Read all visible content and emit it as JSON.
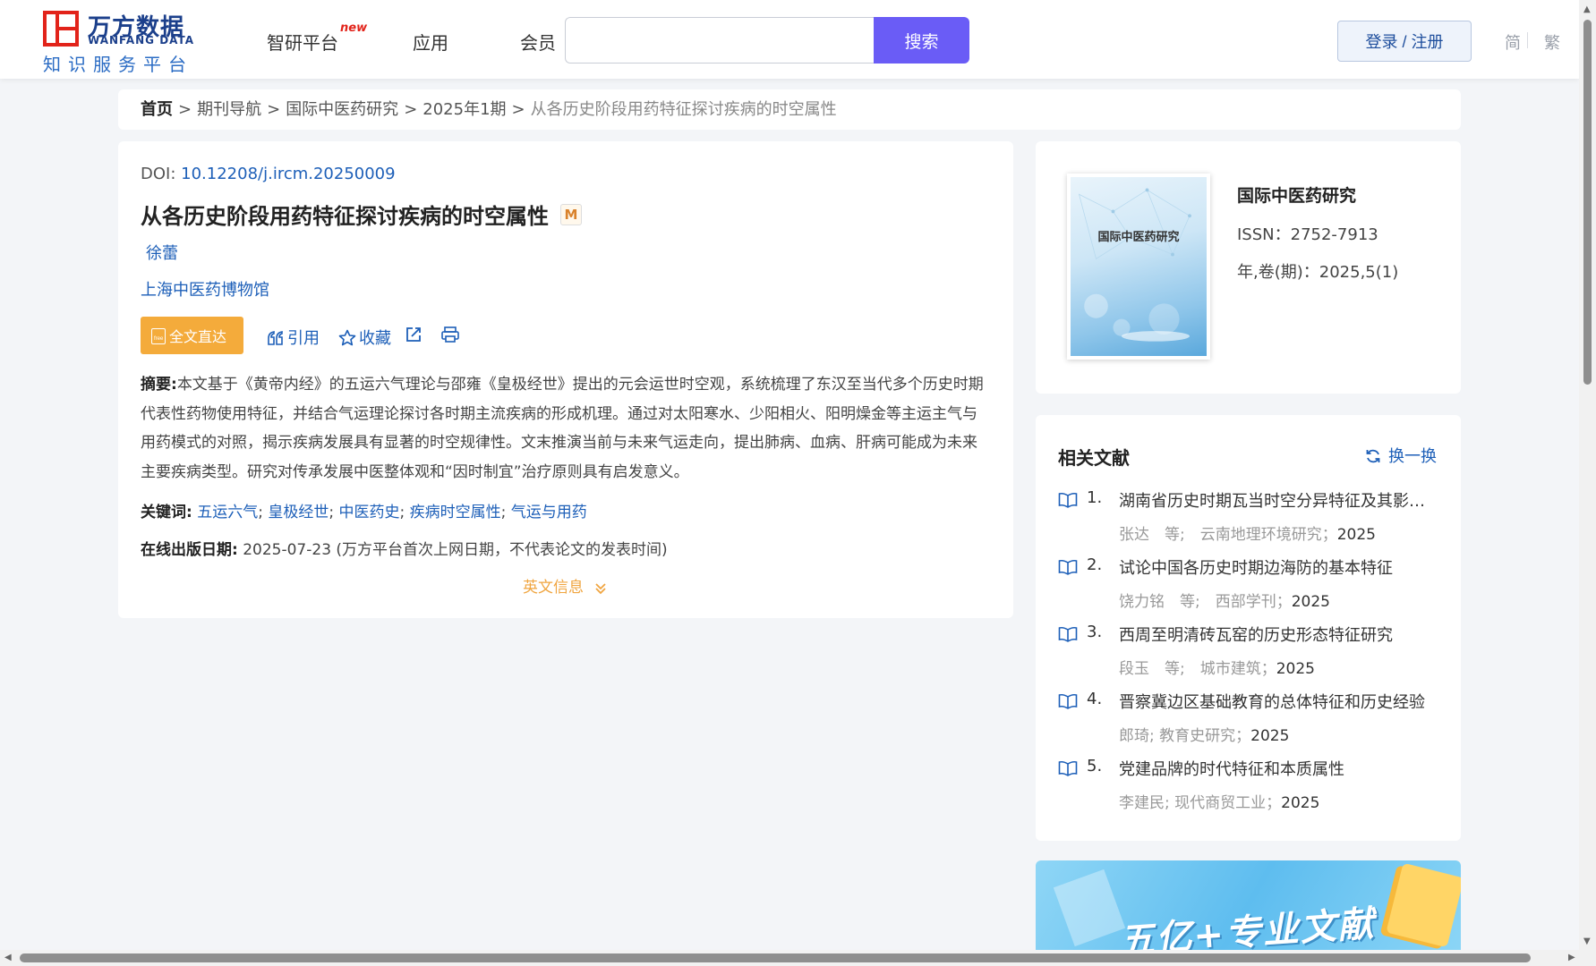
{
  "header": {
    "logo_cn": "万方数据",
    "logo_en": "WANFANG DATA",
    "logo_sub": "知识服务平台",
    "nav": [
      {
        "label": "智研平台",
        "badge": "new"
      },
      {
        "label": "应用"
      },
      {
        "label": "会员"
      }
    ],
    "search_placeholder": "",
    "search_button": "搜索",
    "login_button": "登录 / 注册",
    "lang_simplified": "简",
    "lang_traditional": "繁"
  },
  "breadcrumb": {
    "home": "首页",
    "sep": ">",
    "items": [
      "期刊导航",
      "国际中医药研究",
      "2025年1期"
    ],
    "current": "从各历史阶段用药特征探讨疾病的时空属性"
  },
  "article": {
    "doi_label": "DOI:",
    "doi_value": "10.12208/j.ircm.20250009",
    "title": "从各历史阶段用药特征探讨疾病的时空属性",
    "badge": "M",
    "author": "徐蕾",
    "organization": "上海中医药博物馆",
    "fulltext_button": "全文直达",
    "actions": {
      "cite": "引用",
      "favorite": "收藏"
    },
    "abstract_label": "摘要:",
    "abstract": "本文基于《黄帝内经》的五运六气理论与邵雍《皇极经世》提出的元会运世时空观，系统梳理了东汉至当代多个历史时期代表性药物使用特征，并结合气运理论探讨各时期主流疾病的形成机理。通过对太阳寒水、少阳相火、阳明燥金等主运主气与用药模式的对照，揭示疾病发展具有显著的时空规律性。文末推演当前与未来气运走向，提出肺病、血病、肝病可能成为未来主要疾病类型。研究对传承发展中医整体观和“因时制宜”治疗原则具有启发意义。",
    "keywords_label": "关键词:",
    "keywords": [
      "五运六气",
      "皇极经世",
      "中医药史",
      "疾病时空属性",
      "气运与用药"
    ],
    "keyword_sep": ";",
    "pubdate_label": "在线出版日期:",
    "pubdate_value": "2025-07-23",
    "pubdate_note": "(万方平台首次上网日期，不代表论文的发表时间)",
    "english_info": "英文信息"
  },
  "journal": {
    "cover_title": "国际中医药研究",
    "name": "国际中医药研究",
    "issn": "ISSN：2752-7913",
    "volume": "年,卷(期)：2025,5(1)"
  },
  "related": {
    "title": "相关文献",
    "refresh": "换一换",
    "items": [
      {
        "num": "1.",
        "title": "湖南省历史时期瓦当时空分异特征及其影响...",
        "meta": "张达　等;　云南地理环境研究；",
        "year": "2025"
      },
      {
        "num": "2.",
        "title": "试论中国各历史时期边海防的基本特征",
        "meta": "饶力铭　等;　西部学刊；",
        "year": "2025"
      },
      {
        "num": "3.",
        "title": "西周至明清砖瓦窑的历史形态特征研究",
        "meta": "段玉　等;　城市建筑；",
        "year": "2025"
      },
      {
        "num": "4.",
        "title": "晋察冀边区基础教育的总体特征和历史经验",
        "meta": "郎琦; 教育史研究；",
        "year": "2025"
      },
      {
        "num": "5.",
        "title": "党建品牌的时代特征和本质属性",
        "meta": "李建民; 现代商贸工业；",
        "year": "2025"
      }
    ]
  },
  "banner": {
    "text": "五亿+专业文献"
  },
  "colors": {
    "accent": "#6a5cf6",
    "link": "#1d5fb8",
    "orange": "#f4ab3b"
  }
}
